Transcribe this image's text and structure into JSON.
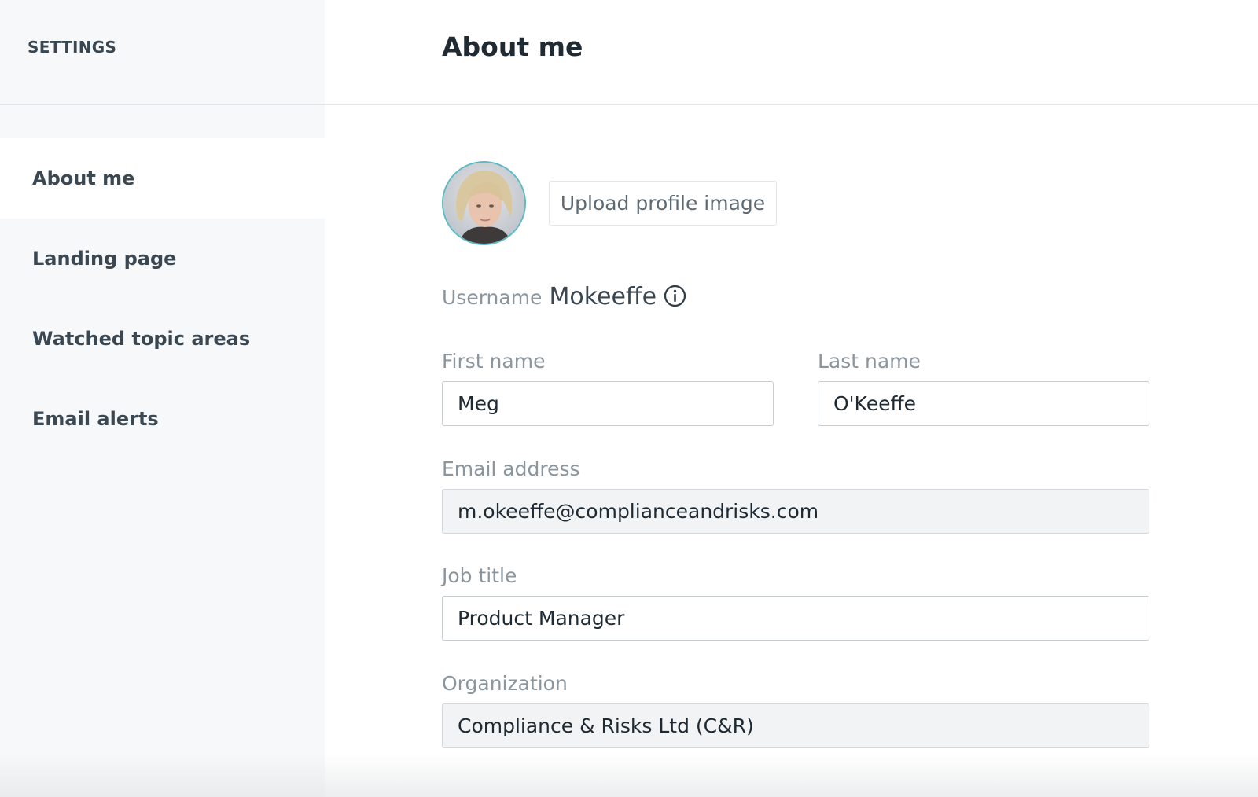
{
  "sidebar": {
    "title": "SETTINGS",
    "items": [
      {
        "label": "About me",
        "active": true
      },
      {
        "label": "Landing page",
        "active": false
      },
      {
        "label": "Watched topic areas",
        "active": false
      },
      {
        "label": "Email alerts",
        "active": false
      }
    ]
  },
  "page": {
    "title": "About me"
  },
  "profile": {
    "upload_label": "Upload profile image",
    "username_label": "Username",
    "username_value": "Mokeeffe"
  },
  "form": {
    "first_name": {
      "label": "First name",
      "value": "Meg"
    },
    "last_name": {
      "label": "Last name",
      "value": "O'Keeffe"
    },
    "email": {
      "label": "Email address",
      "value": "m.okeeffe@complianceandrisks.com",
      "readonly": true
    },
    "job_title": {
      "label": "Job title",
      "value": "Product Manager"
    },
    "organization": {
      "label": "Organization",
      "value": "Compliance & Risks Ltd (C&R)",
      "readonly": true
    }
  },
  "colors": {
    "sidebar_bg": "#f7f8f9",
    "avatar_ring": "#5fb8c2",
    "readonly_bg": "#f2f3f4"
  },
  "icons": {
    "username_info": "info-circle-icon"
  }
}
